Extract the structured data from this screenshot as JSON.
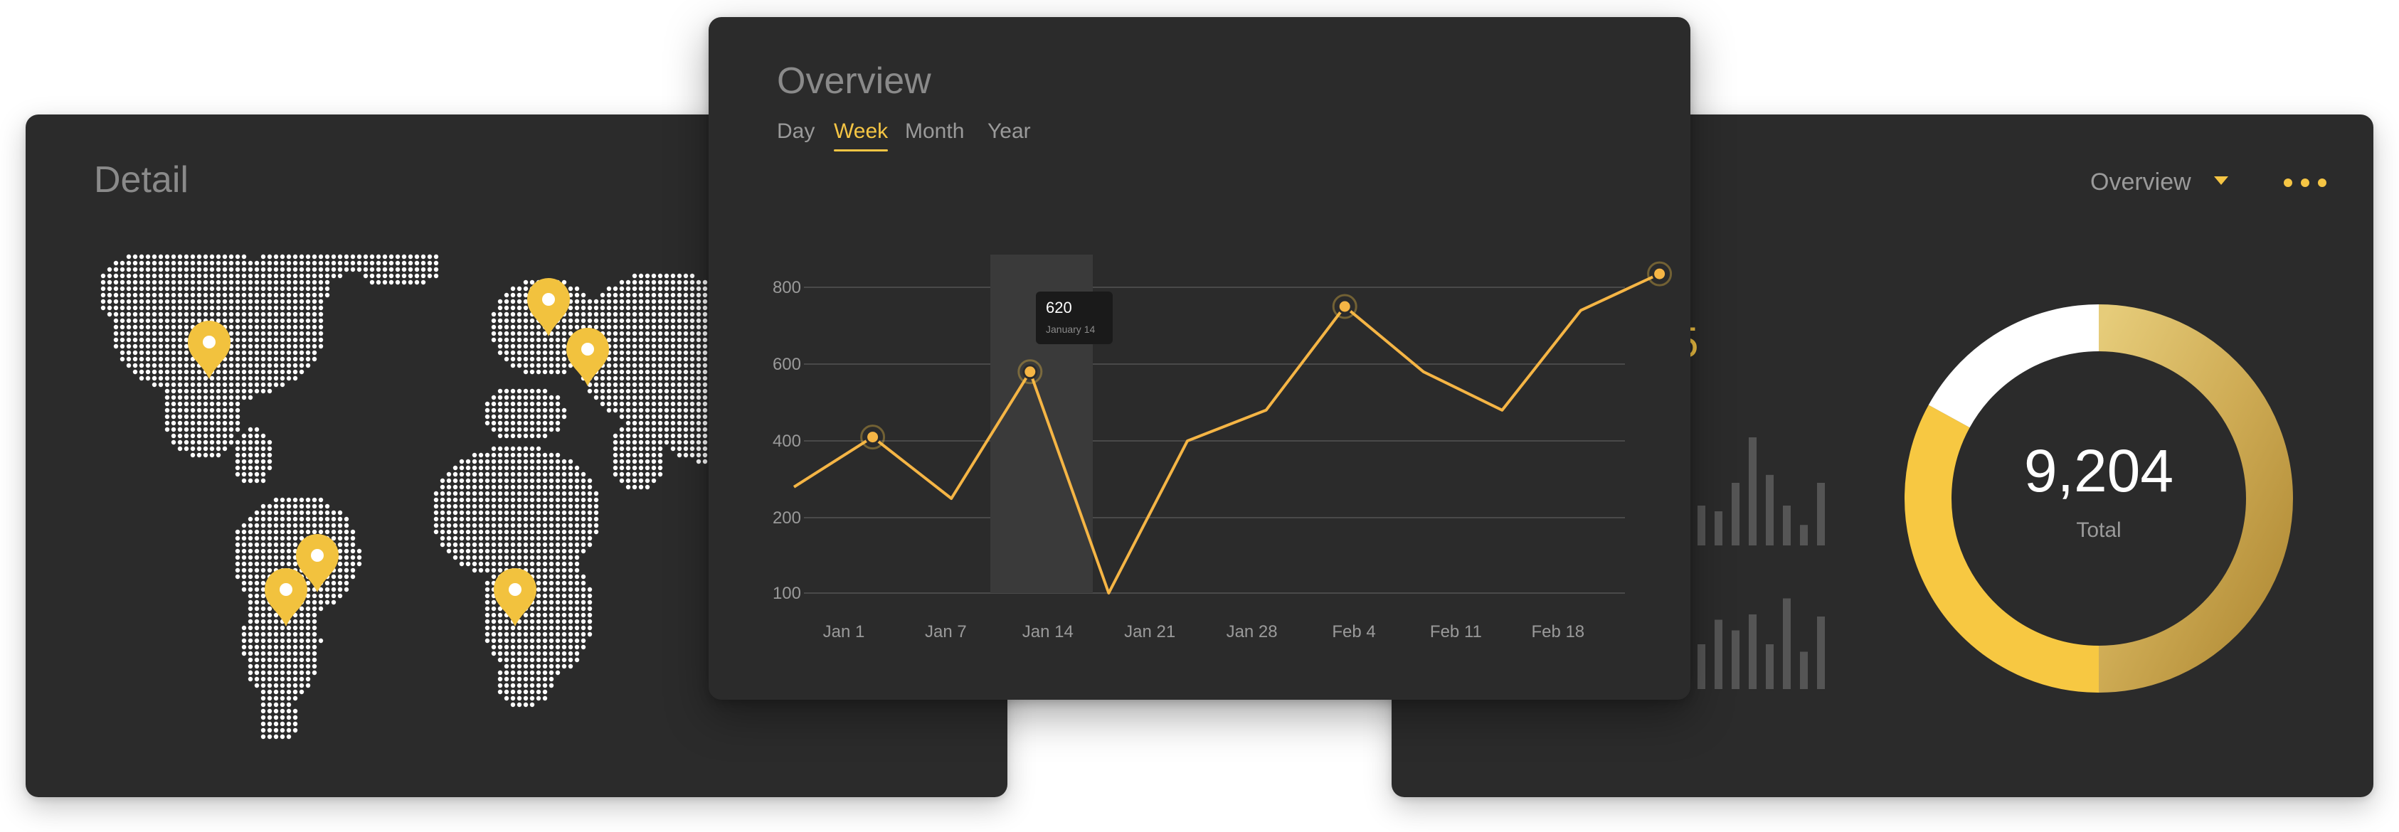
{
  "detail": {
    "title": "Detail"
  },
  "overview": {
    "title": "Overview",
    "tabs": [
      {
        "label": "Day",
        "active": false
      },
      {
        "label": "Week",
        "active": true
      },
      {
        "label": "Month",
        "active": false
      },
      {
        "label": "Year",
        "active": false
      }
    ],
    "tooltip": {
      "value": "620",
      "date": "January 14"
    }
  },
  "summary": {
    "dropdown_label": "Overview",
    "dropdown_icon": "caret-down-icon",
    "more_icon": "more-horizontal-icon",
    "partial_value_glyph": "5",
    "donut_value": "9,204",
    "donut_label": "Total"
  },
  "colors": {
    "card_bg": "#2b2b2b",
    "accent": "#f5c544",
    "line": "#f5b545",
    "text_muted": "#9a9a9a",
    "grid": "#4a4a4a",
    "pin": "#f2c23e"
  },
  "chart_data": [
    {
      "type": "line",
      "title": "",
      "xlabel": "",
      "ylabel": "",
      "x_tick_labels": [
        "Jan 1",
        "Jan 7",
        "Jan 14",
        "Jan 21",
        "Jan 28",
        "Feb 4",
        "Feb 11",
        "Feb 18"
      ],
      "y_ticks": [
        100,
        200,
        400,
        600,
        800
      ],
      "ylim": [
        100,
        800
      ],
      "grid": true,
      "highlighted_point": 4,
      "marked_points": [
        1,
        4,
        7,
        12
      ],
      "series": [
        {
          "values": [
            [
              0,
              280
            ],
            [
              1,
              410
            ],
            [
              2,
              250
            ],
            [
              3,
              580
            ],
            [
              4,
              100
            ],
            [
              5,
              400
            ],
            [
              6,
              480
            ],
            [
              7,
              750
            ],
            [
              8,
              580
            ],
            [
              9,
              480
            ],
            [
              10,
              740
            ],
            [
              11,
              835
            ]
          ]
        }
      ]
    },
    {
      "type": "pie",
      "title": "",
      "segments": [
        {
          "value": 50,
          "color": "gradient-gold"
        },
        {
          "value": 33,
          "color": "#f7c842"
        },
        {
          "value": 17,
          "color": "#ffffff"
        }
      ],
      "total_label": "9,204"
    },
    {
      "type": "bar",
      "title": "",
      "values": [
        0.35,
        0.3,
        0.55,
        0.95,
        0.62,
        0.35,
        0.18,
        0.55
      ]
    },
    {
      "type": "bar",
      "title": "",
      "values": [
        0.42,
        0.65,
        0.55,
        0.7,
        0.42,
        0.85,
        0.35,
        0.68
      ]
    }
  ],
  "map": {
    "pins": [
      {
        "name": "north-america",
        "fx": 0.264,
        "fy": 0.38
      },
      {
        "name": "south-america-north",
        "fx": 0.422,
        "fy": 0.64
      },
      {
        "name": "south-america-south",
        "fx": 0.368,
        "fy": 0.685
      },
      {
        "name": "europe",
        "fx": 0.718,
        "fy": 0.35
      },
      {
        "name": "eastern-europe",
        "fx": 0.77,
        "fy": 0.435
      },
      {
        "name": "africa",
        "fx": 0.676,
        "fy": 0.685
      }
    ]
  }
}
